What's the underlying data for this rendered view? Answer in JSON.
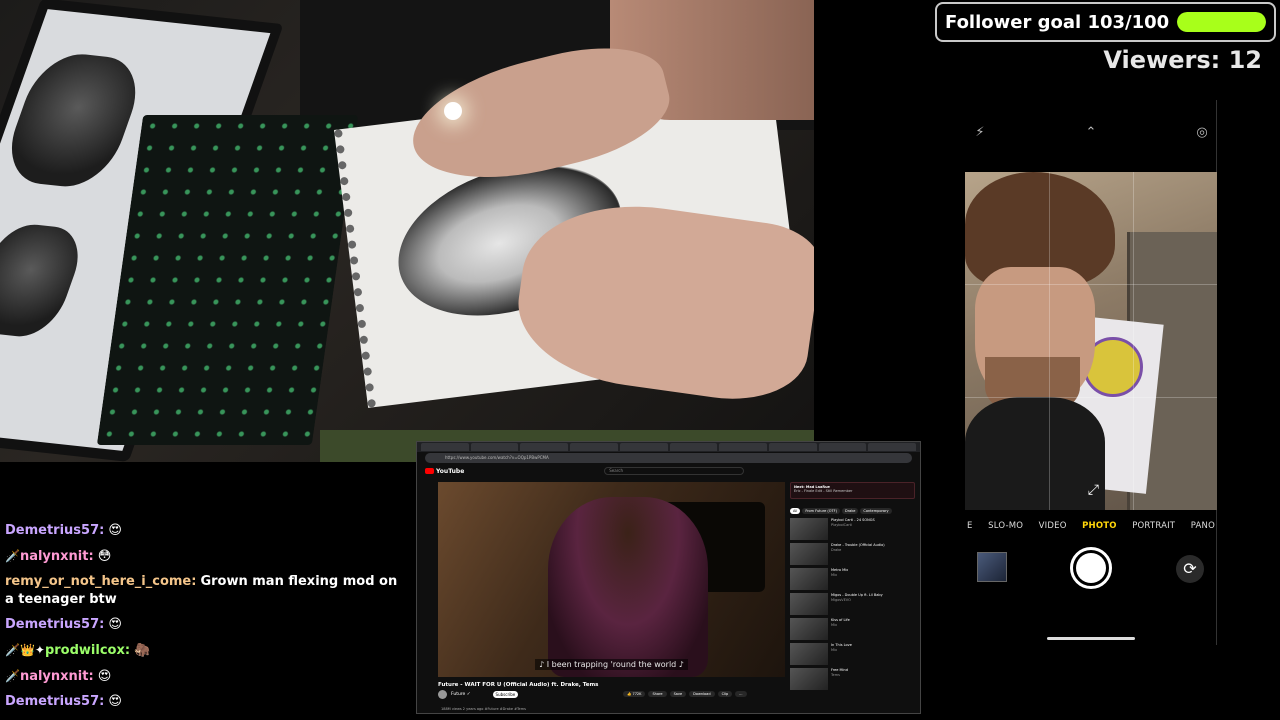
{
  "follower_goal": {
    "label": "Follower goal 103/100",
    "progress_fraction": 1.0,
    "bar_color": "#a8ff1a"
  },
  "viewers": {
    "label": "Viewers:",
    "count": "12"
  },
  "phone_camera": {
    "top_icons": [
      "flash-off-icon",
      "chevron-up-icon",
      "live-photo-icon"
    ],
    "modes": [
      {
        "label": "E",
        "active": false
      },
      {
        "label": "SLO-MO",
        "active": false
      },
      {
        "label": "VIDEO",
        "active": false
      },
      {
        "label": "PHOTO",
        "active": true
      },
      {
        "label": "PORTRAIT",
        "active": false
      },
      {
        "label": "PANO",
        "active": false
      }
    ],
    "active_color": "#ffd60a"
  },
  "chat": {
    "messages": [
      {
        "badges": "",
        "user": "Demetrius57:",
        "user_color": "#c9a6ff",
        "text": "😍"
      },
      {
        "badges": "🗡️",
        "user": "nalynxnit:",
        "user_color": "#ff9bd4",
        "text": "😳"
      },
      {
        "badges": "",
        "user": "remy_or_not_here_i_come:",
        "user_color": "#f4c58a",
        "text": "Grown man flexing mod on a teenager btw"
      },
      {
        "badges": "",
        "user": "Demetrius57:",
        "user_color": "#c9a6ff",
        "text": "😍"
      },
      {
        "badges": "🗡️👑✦",
        "user": "prodwilcox:",
        "user_color": "#9cff6a",
        "text": "🦣"
      },
      {
        "badges": "🗡️",
        "user": "nalynxnit:",
        "user_color": "#ff9bd4",
        "text": "😍"
      },
      {
        "badges": "",
        "user": "Demetrius57:",
        "user_color": "#c9a6ff",
        "text": "😍"
      }
    ]
  },
  "youtube": {
    "url": "https://www.youtube.com/watch?v=OQp1PBwPCMA",
    "logo": "YouTube",
    "search_placeholder": "Search",
    "caption": "♪ I been trapping 'round the world ♪",
    "video_title": "Future - WAIT FOR U (Official Audio) ft. Drake, Tems",
    "channel": "Future ✓",
    "subscribe": "Subscribe",
    "actions": [
      "👍 772K",
      "Share",
      "Save",
      "Download",
      "Clip",
      "..."
    ],
    "stats": "188M views  2 years ago  #Future #Drake #Tems",
    "ad": {
      "title": "Next: Mad LaaRue",
      "subtitle": "Eric - Finale Edit - Still Remember"
    },
    "chips": [
      {
        "label": "All",
        "active": true
      },
      {
        "label": "From Future (OTF)",
        "active": false
      },
      {
        "label": "Drake",
        "active": false
      },
      {
        "label": "Contemporary",
        "active": false
      }
    ],
    "recommendations": [
      {
        "title": "Playboi Carti - 24 SONGS",
        "meta": "PlayboiCarti"
      },
      {
        "title": "Drake - Trouble (Official Audio)",
        "meta": "Drake"
      },
      {
        "title": "Metro Mix",
        "meta": "Mix"
      },
      {
        "title": "Migos - Double Up ft. Lil Baby",
        "meta": "MigosVEVO"
      },
      {
        "title": "Kiss of Life",
        "meta": "Mix"
      },
      {
        "title": "In This Love",
        "meta": "Mix"
      },
      {
        "title": "Free Mind",
        "meta": "Tems"
      }
    ]
  }
}
